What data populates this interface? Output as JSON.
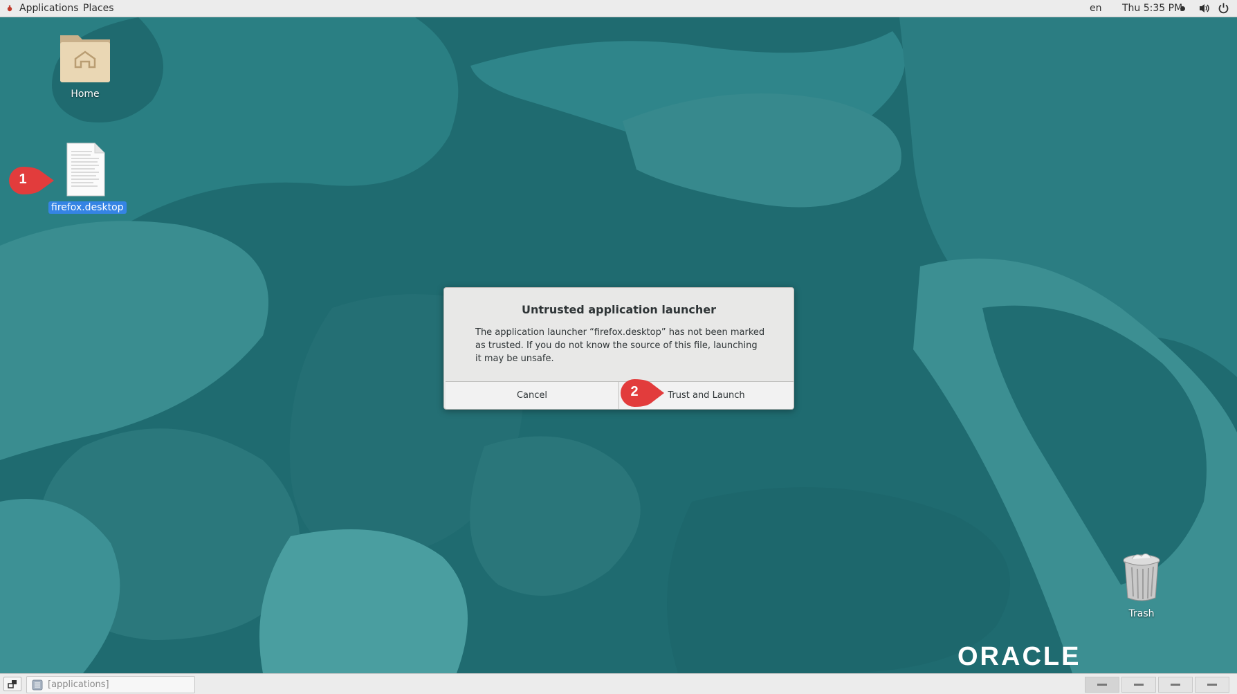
{
  "topbar": {
    "applications": "Applications",
    "places": "Places",
    "language": "en",
    "clock": "Thu  5:35 PM"
  },
  "desktop": {
    "icons": [
      {
        "label": "Home"
      },
      {
        "label": "firefox.desktop"
      },
      {
        "label": "Trash"
      }
    ],
    "logo_text": "ORACLE"
  },
  "callouts": {
    "first": "1",
    "second": "2"
  },
  "dialog": {
    "title": "Untrusted application launcher",
    "message": "The application launcher “firefox.desktop” has not been marked as trusted. If you do not know the source of this file, launching it may be unsafe.",
    "cancel_label": "Cancel",
    "trust_label": "Trust and Launch"
  },
  "taskbar": {
    "window_label": "[applications]",
    "workspace_count": 4
  },
  "colors": {
    "wallpaper": "#1f6b70",
    "callout": "#e23c3c",
    "selection": "#3584e4"
  }
}
